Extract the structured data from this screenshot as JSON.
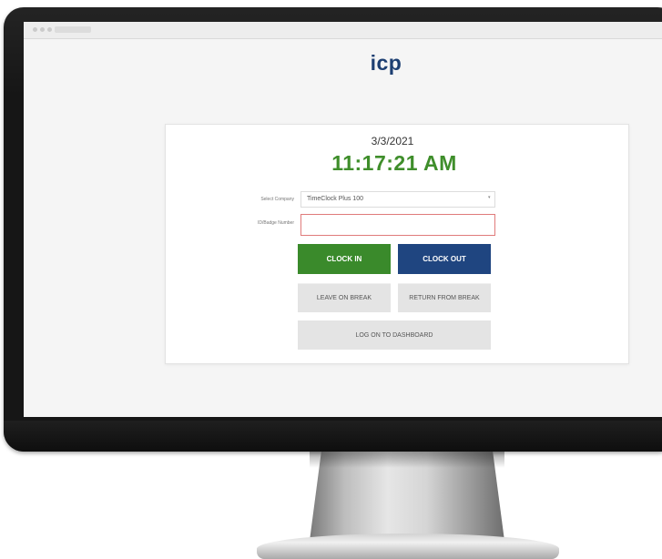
{
  "app": {
    "logo_text": "icp",
    "colors": {
      "brand_navy": "#1f4580",
      "brand_green": "#3a8a2b",
      "clock_green": "#3f8e2b",
      "input_error_border": "#e07b7b"
    }
  },
  "clock": {
    "date": "3/3/2021",
    "time": "11:17:21 AM"
  },
  "form": {
    "company_label": "Select Company",
    "company_value": "TimeClock Plus 100",
    "id_label": "ID/Badge Number",
    "id_value": ""
  },
  "buttons": {
    "clock_in": "CLOCK IN",
    "clock_out": "CLOCK OUT",
    "leave_on_break": "LEAVE ON BREAK",
    "return_from_break": "RETURN FROM BREAK",
    "log_on_dashboard": "LOG ON TO DASHBOARD"
  }
}
